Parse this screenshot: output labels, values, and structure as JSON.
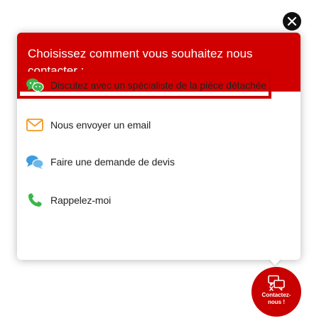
{
  "popup": {
    "title": "Choisissez comment vous souhaitez nous contacter :",
    "options": [
      {
        "label": "Discutez avec un spécialiste de la pièce détachée",
        "icon": "chat-bubbles-icon",
        "color": "#3cb64a"
      },
      {
        "label": "Nous envoyer un email",
        "icon": "envelope-icon",
        "color": "#f29a1f"
      },
      {
        "label": "Faire une demande de devis",
        "icon": "speech-bubbles-icon",
        "color": "#3b9de0"
      },
      {
        "label": "Rappelez-moi",
        "icon": "phone-icon",
        "color": "#3cb64a"
      }
    ]
  },
  "fab": {
    "label": "Contactez-nous !",
    "icon": "chat-icon"
  },
  "close": {
    "icon": "close-icon"
  },
  "colors": {
    "brand_red": "#d10000",
    "highlight_red": "#c80000"
  }
}
